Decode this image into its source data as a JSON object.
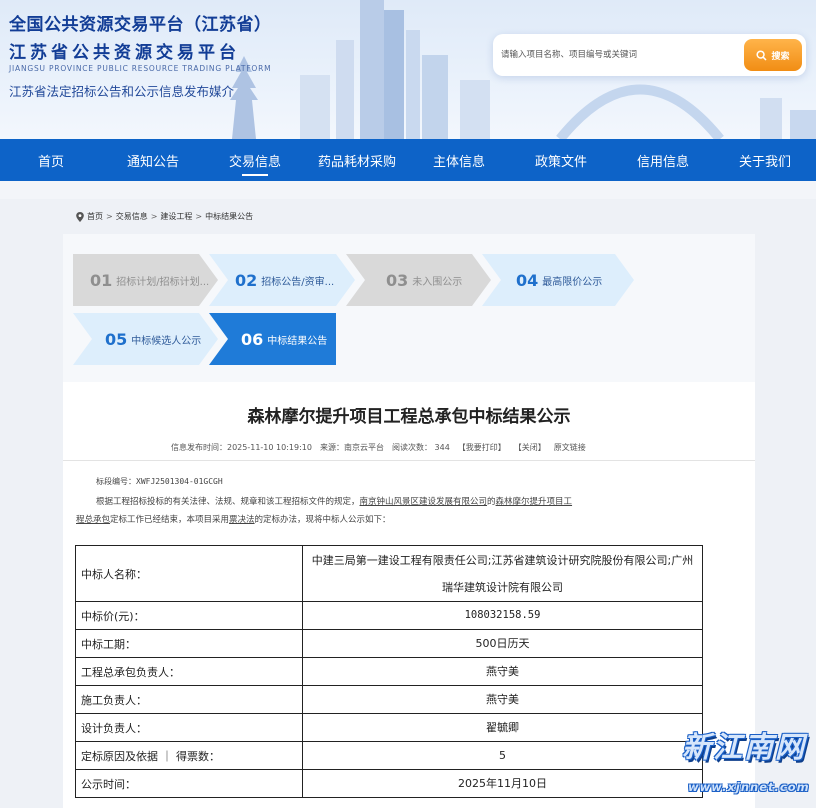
{
  "header": {
    "title": "全国公共资源交易平台（江苏省）",
    "subtitle": "江苏省公共资源交易平台",
    "english": "JIANGSU PROVINCE PUBLIC RESOURCE TRADING PLATFORM",
    "tagline": "江苏省法定招标公告和公示信息发布媒介"
  },
  "search": {
    "placeholder": "请输入项目名称、项目编号或关键词",
    "button": "搜索",
    "icon": "search-icon"
  },
  "nav": {
    "items": [
      "首页",
      "通知公告",
      "交易信息",
      "药品耗材采购",
      "主体信息",
      "政策文件",
      "信用信息",
      "关于我们"
    ],
    "active": "交易信息"
  },
  "breadcrumb": {
    "icon": "location-pin-icon",
    "items": [
      "首页",
      "交易信息",
      "建设工程",
      "中标结果公告"
    ],
    "separator": ">"
  },
  "steps": [
    {
      "num": "01",
      "label": "招标计划/招标计划...",
      "state": "inactive"
    },
    {
      "num": "02",
      "label": "招标公告/资审...",
      "state": "available"
    },
    {
      "num": "03",
      "label": "未入围公示",
      "state": "inactive"
    },
    {
      "num": "04",
      "label": "最高限价公示",
      "state": "available"
    },
    {
      "num": "05",
      "label": "中标候选人公示",
      "state": "available"
    },
    {
      "num": "06",
      "label": "中标结果公告",
      "state": "current"
    }
  ],
  "notice": {
    "title": "森林摩尔提升项目工程总承包中标结果公示",
    "meta": {
      "publish_time": "信息发布时间：2025-11-10 10:19:10",
      "source": "来源：南京云平台",
      "views": "阅读次数：  344",
      "print": "【我要打印】",
      "close": "【关闭】",
      "original": "原文链接"
    },
    "section_no": "标段编号：XWFJ2501304-01GCGH",
    "para_1": "根据工程招标投标的有关法律、法规、规章和该工程招标文件的规定，",
    "para_link_tenderee": "南京钟山风景区建设发展有限公司",
    "para_2": "的",
    "para_link_project_a": "森林摩尔提升项目工",
    "para_link_project_b": "程总承包",
    "para_3": "定标工作已经结束，本项目采用",
    "para_link_method": "票决法",
    "para_4": "的定标办法，现将中标人公示如下："
  },
  "result_table": [
    {
      "key": "中标人名称：",
      "value": "中建三局第一建设工程有限责任公司;江苏省建筑设计研究院股份有限公司;广州瑞华建筑设计院有限公司"
    },
    {
      "key": "中标价(元)：",
      "value": "108032158.59"
    },
    {
      "key": "中标工期：",
      "value": "500日历天"
    },
    {
      "key": "工程总承包负责人：",
      "value": "燕守美"
    },
    {
      "key": "施工负责人：",
      "value": "燕守美"
    },
    {
      "key": "设计负责人：",
      "value": "翟毓卿"
    },
    {
      "key": "定标原因及依据 ｜ 得票数：",
      "value": "5"
    },
    {
      "key": "公示时间：",
      "value": "2025年11月10日"
    }
  ],
  "watermark": {
    "title": "新江南网",
    "url": "www.xjnnet.com"
  },
  "colors": {
    "nav_blue": "#0d63c8",
    "title_blue": "#123d96",
    "search_orange": "#f18d14",
    "step_blue": "#1f7bd8",
    "step_light": "#ddeefc",
    "step_gray": "#d9d9d9"
  }
}
